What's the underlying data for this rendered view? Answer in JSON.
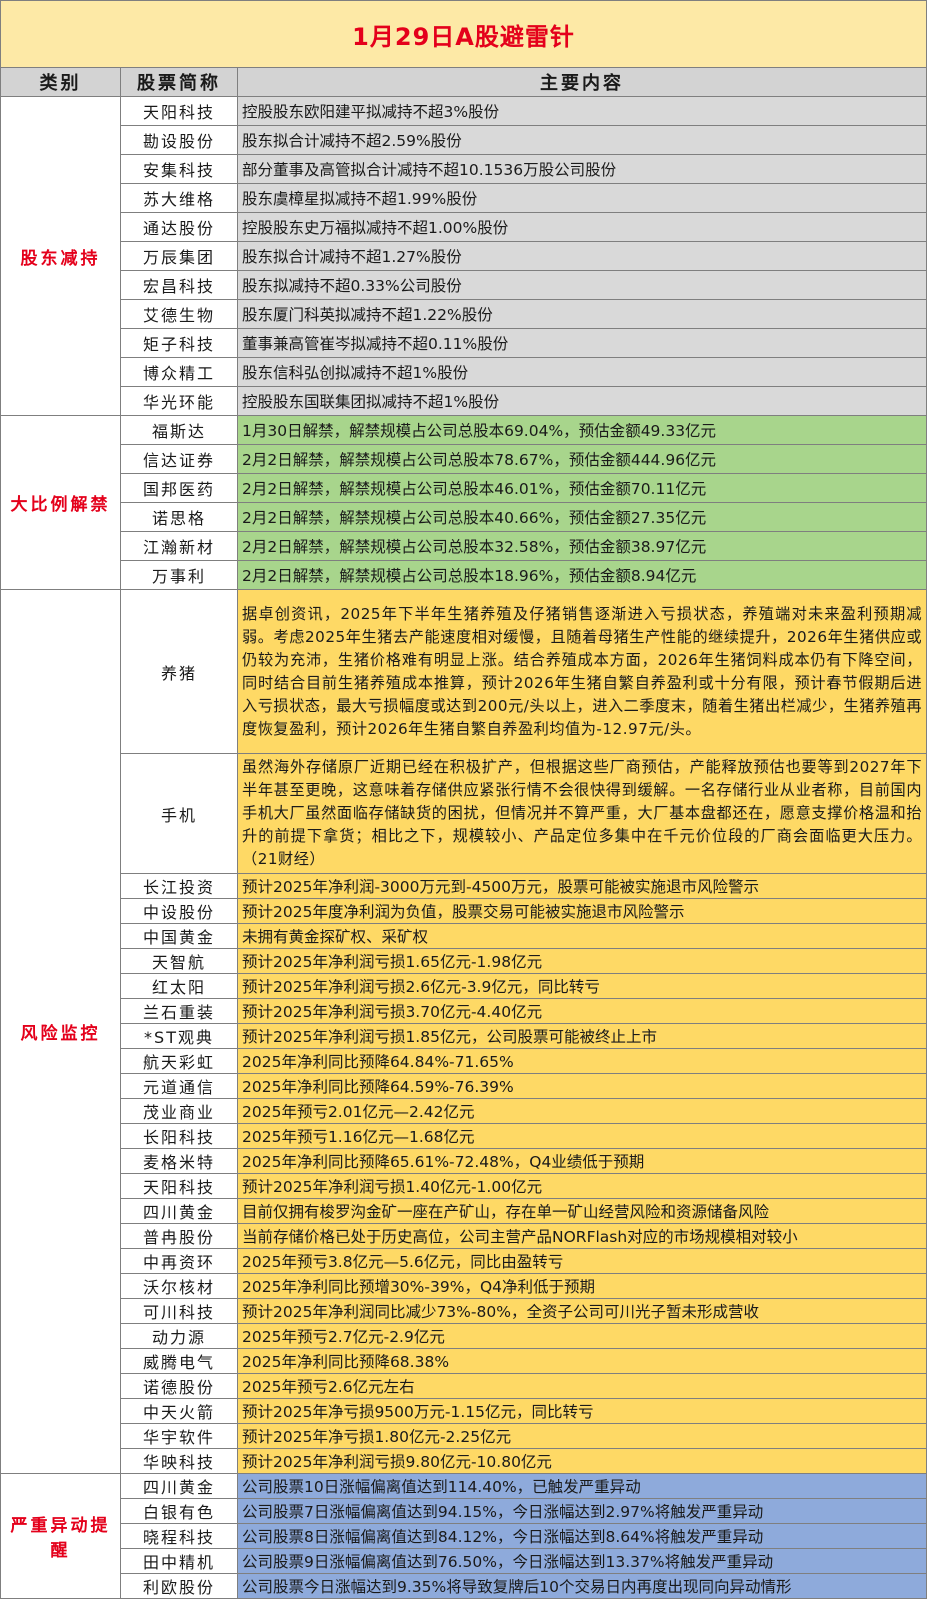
{
  "title": "1月29日A股避雷针",
  "headers": {
    "category": "类别",
    "stock": "股票简称",
    "content": "主要内容"
  },
  "sections": [
    {
      "category": "股东减持",
      "color": "#d9d9d9",
      "rows": [
        {
          "stock": "天阳科技",
          "content": "控股股东欧阳建平拟减持不超3%股份"
        },
        {
          "stock": "勘设股份",
          "content": "股东拟合计减持不超2.59%股份"
        },
        {
          "stock": "安集科技",
          "content": "部分董事及高管拟合计减持不超10.1536万股公司股份"
        },
        {
          "stock": "苏大维格",
          "content": "股东虞樟星拟减持不超1.99%股份"
        },
        {
          "stock": "通达股份",
          "content": "控股股东史万福拟减持不超1.00%股份"
        },
        {
          "stock": "万辰集团",
          "content": "股东拟合计减持不超1.27%股份"
        },
        {
          "stock": "宏昌科技",
          "content": "股东拟减持不超0.33%公司股份"
        },
        {
          "stock": "艾德生物",
          "content": "股东厦门科英拟减持不超1.22%股份"
        },
        {
          "stock": "矩子科技",
          "content": "董事兼高管崔岑拟减持不超0.11%股份"
        },
        {
          "stock": "博众精工",
          "content": "股东信科弘创拟减持不超1%股份"
        },
        {
          "stock": "华光环能",
          "content": "控股股东国联集团拟减持不超1%股份"
        }
      ]
    },
    {
      "category": "大比例解禁",
      "color": "#a8d58c",
      "rows": [
        {
          "stock": "福斯达",
          "content": "1月30日解禁，解禁规模占公司总股本69.04%，预估金额49.33亿元"
        },
        {
          "stock": "信达证券",
          "content": "2月2日解禁，解禁规模占公司总股本78.67%，预估金额444.96亿元"
        },
        {
          "stock": "国邦医药",
          "content": "2月2日解禁，解禁规模占公司总股本46.01%，预估金额70.11亿元"
        },
        {
          "stock": "诺思格",
          "content": "2月2日解禁，解禁规模占公司总股本40.66%，预估金额27.35亿元"
        },
        {
          "stock": "江瀚新材",
          "content": "2月2日解禁，解禁规模占公司总股本32.58%，预估金额38.97亿元"
        },
        {
          "stock": "万事利",
          "content": "2月2日解禁，解禁规模占公司总股本18.96%，预估金额8.94亿元"
        }
      ]
    },
    {
      "category": "风险监控",
      "color": "#fed965",
      "rows": [
        {
          "stock": "养猪",
          "content": "据卓创资讯，2025年下半年生猪养殖及仔猪销售逐渐进入亏损状态，养殖端对未来盈利预期减弱。考虑2025年生猪去产能速度相对缓慢，且随着母猪生产性能的继续提升，2026年生猪供应或仍较为充沛，生猪价格难有明显上涨。结合养殖成本方面，2026年生猪饲料成本仍有下降空间，同时结合目前生猪养殖成本推算，预计2026年生猪自繁自养盈利或十分有限，预计春节假期后进入亏损状态，最大亏损幅度或达到200元/头以上，进入二季度末，随着生猪出栏减少，生猪养殖再度恢复盈利，预计2026年生猪自繁自养盈利均值为-12.97元/头。"
        },
        {
          "stock": "手机",
          "content": "虽然海外存储原厂近期已经在积极扩产，但根据这些厂商预估，产能释放预估也要等到2027年下半年甚至更晚，这意味着存储供应紧张行情不会很快得到缓解。一名存储行业从业者称，目前国内手机大厂虽然面临存储缺货的困扰，但情况并不算严重，大厂基本盘都还在，愿意支撑价格温和抬升的前提下拿货；相比之下，规模较小、产品定位多集中在千元价位段的厂商会面临更大压力。（21财经）"
        },
        {
          "stock": "长江投资",
          "content": "预计2025年净利润-3000万元到-4500万元，股票可能被实施退市风险警示"
        },
        {
          "stock": "中设股份",
          "content": "预计2025年度净利润为负值，股票交易可能被实施退市风险警示"
        },
        {
          "stock": "中国黄金",
          "content": "未拥有黄金探矿权、采矿权"
        },
        {
          "stock": "天智航",
          "content": "预计2025年净利润亏损1.65亿元-1.98亿元"
        },
        {
          "stock": "红太阳",
          "content": "预计2025年净利润亏损2.6亿元-3.9亿元，同比转亏"
        },
        {
          "stock": "兰石重装",
          "content": "预计2025年净利润亏损3.70亿元-4.40亿元"
        },
        {
          "stock": "*ST观典",
          "content": "预计2025年净利润亏损1.85亿元，公司股票可能被终止上市"
        },
        {
          "stock": "航天彩虹",
          "content": "2025年净利同比预降64.84%-71.65%"
        },
        {
          "stock": "元道通信",
          "content": "2025年净利同比预降64.59%-76.39%"
        },
        {
          "stock": "茂业商业",
          "content": "2025年预亏2.01亿元—2.42亿元"
        },
        {
          "stock": "长阳科技",
          "content": "2025年预亏1.16亿元—1.68亿元"
        },
        {
          "stock": "麦格米特",
          "content": "2025年净利同比预降65.61%-72.48%，Q4业绩低于预期"
        },
        {
          "stock": "天阳科技",
          "content": "预计2025年净利润亏损1.40亿元-1.00亿元"
        },
        {
          "stock": "四川黄金",
          "content": "目前仅拥有梭罗沟金矿一座在产矿山，存在单一矿山经营风险和资源储备风险"
        },
        {
          "stock": "普冉股份",
          "content": "当前存储价格已处于历史高位，公司主营产品NORFlash对应的市场规模相对较小"
        },
        {
          "stock": "中再资环",
          "content": "2025年预亏3.8亿元—5.6亿元，同比由盈转亏"
        },
        {
          "stock": "沃尔核材",
          "content": "2025年净利同比预增30%-39%，Q4净利低于预期"
        },
        {
          "stock": "可川科技",
          "content": "预计2025年净利润同比减少73%-80%，全资子公司可川光子暂未形成营收"
        },
        {
          "stock": "动力源",
          "content": "2025年预亏2.7亿元-2.9亿元"
        },
        {
          "stock": "威腾电气",
          "content": "2025年净利同比预降68.38%"
        },
        {
          "stock": "诺德股份",
          "content": "2025年预亏2.6亿元左右"
        },
        {
          "stock": "中天火箭",
          "content": "预计2025年净亏损9500万元-1.15亿元，同比转亏"
        },
        {
          "stock": "华宇软件",
          "content": "预计2025年净亏损1.80亿元-2.25亿元"
        },
        {
          "stock": "华映科技",
          "content": "预计2025年净利润亏损9.80亿元-10.80亿元"
        }
      ]
    },
    {
      "category": "严重异动提醒",
      "color": "#8eaadb",
      "rows": [
        {
          "stock": "四川黄金",
          "content": "公司股票10日涨幅偏离值达到114.40%，已触发严重异动"
        },
        {
          "stock": "白银有色",
          "content": "公司股票7日涨幅偏离值达到94.15%，今日涨幅达到2.97%将触发严重异动"
        },
        {
          "stock": "晓程科技",
          "content": "公司股票8日涨幅偏离值达到84.12%，今日涨幅达到8.64%将触发严重异动"
        },
        {
          "stock": "田中精机",
          "content": "公司股票9日涨幅偏离值达到76.50%，今日涨幅达到13.37%将触发严重异动"
        },
        {
          "stock": "利欧股份",
          "content": "公司股票今日涨幅达到9.35%将导致复牌后10个交易日内再度出现同向异动情形"
        }
      ]
    }
  ]
}
